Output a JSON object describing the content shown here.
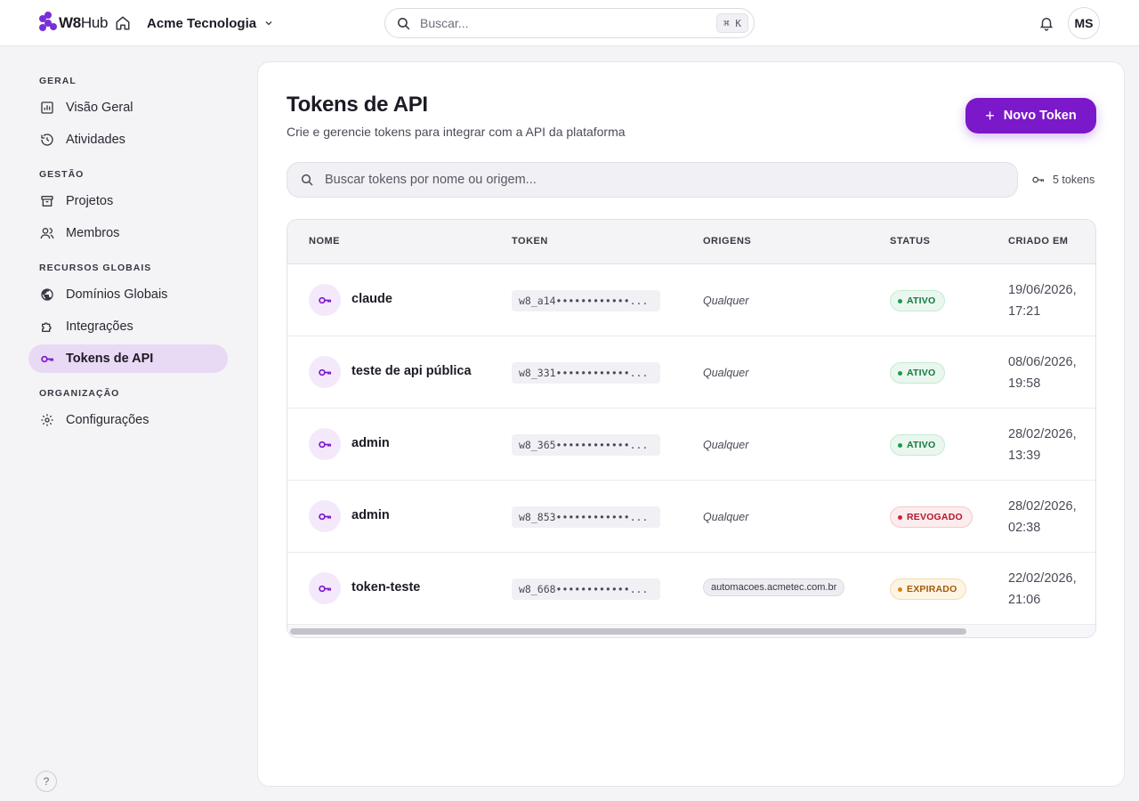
{
  "brand": {
    "name_bold": "W8",
    "name_light": "Hub"
  },
  "org": {
    "name": "Acme Tecnologia"
  },
  "search": {
    "placeholder": "Buscar...",
    "shortcut": "⌘ K"
  },
  "user": {
    "initials": "MS"
  },
  "sidebar": {
    "sections": [
      {
        "title": "GERAL",
        "items": [
          {
            "label": "Visão Geral",
            "icon": "chart-icon"
          },
          {
            "label": "Atividades",
            "icon": "history-icon"
          }
        ]
      },
      {
        "title": "GESTÃO",
        "items": [
          {
            "label": "Projetos",
            "icon": "archive-icon"
          },
          {
            "label": "Membros",
            "icon": "users-icon"
          }
        ]
      },
      {
        "title": "RECURSOS GLOBAIS",
        "items": [
          {
            "label": "Domínios Globais",
            "icon": "globe-icon"
          },
          {
            "label": "Integrações",
            "icon": "puzzle-icon"
          },
          {
            "label": "Tokens de API",
            "icon": "key-icon",
            "active": true
          }
        ]
      },
      {
        "title": "ORGANIZAÇÃO",
        "items": [
          {
            "label": "Configurações",
            "icon": "gear-icon"
          }
        ]
      }
    ],
    "help_label": "?"
  },
  "page": {
    "title": "Tokens de API",
    "subtitle": "Crie e gerencie tokens para integrar com a API da plataforma",
    "new_button": "Novo Token",
    "token_search_placeholder": "Buscar tokens por nome ou origem...",
    "token_count": "5 tokens"
  },
  "table": {
    "columns": [
      "NOME",
      "TOKEN",
      "ORIGENS",
      "STATUS",
      "CRIADO EM"
    ],
    "rows": [
      {
        "name": "claude",
        "token": "w8_a14••••••••••••...",
        "origin": "Qualquer",
        "status": "ATIVO",
        "created_date": "19/06/2026,",
        "created_time": "17:21"
      },
      {
        "name": "teste de api pública",
        "token": "w8_331••••••••••••...",
        "origin": "Qualquer",
        "status": "ATIVO",
        "created_date": "08/06/2026,",
        "created_time": "19:58"
      },
      {
        "name": "admin",
        "token": "w8_365••••••••••••...",
        "origin": "Qualquer",
        "status": "ATIVO",
        "created_date": "28/02/2026,",
        "created_time": "13:39"
      },
      {
        "name": "admin",
        "token": "w8_853••••••••••••...",
        "origin": "Qualquer",
        "status": "REVOGADO",
        "created_date": "28/02/2026,",
        "created_time": "02:38"
      },
      {
        "name": "token-teste",
        "token": "w8_668••••••••••••...",
        "origin": "automacoes.acmetec.com.br",
        "status": "EXPIRADO",
        "created_date": "22/02/2026,",
        "created_time": "21:06"
      }
    ]
  },
  "colors": {
    "accent": "#7b18c9",
    "active_nav_bg": "#e8d9f5",
    "status_active": "#157a3e",
    "status_revoked": "#b3172d",
    "status_expired": "#a45a0b"
  }
}
